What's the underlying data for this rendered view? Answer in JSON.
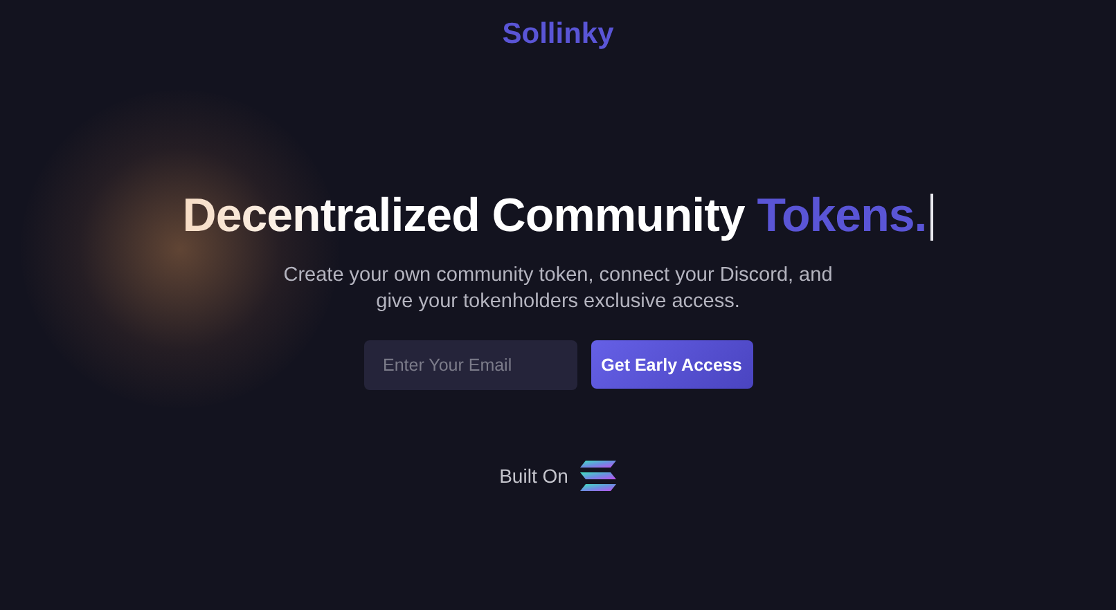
{
  "brand": {
    "title": "Sollinky"
  },
  "hero": {
    "headline": "Decentralized Community ",
    "highlight": "Tokens.",
    "cursor": true,
    "subtitle": "Create your own community token, connect your Discord, and give your tokenholders exclusive access."
  },
  "signup": {
    "email": {
      "placeholder": "Enter Your Email"
    },
    "button": "Get Early Access"
  },
  "footer": {
    "label": "Built On"
  }
}
